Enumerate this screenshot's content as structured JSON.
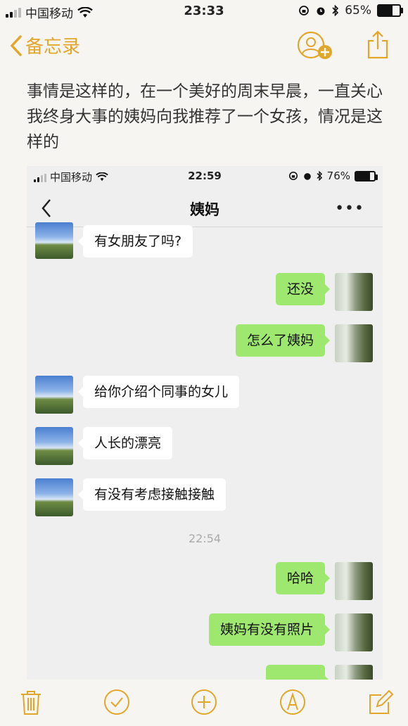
{
  "status": {
    "carrier": "中国移动",
    "time": "23:33",
    "battery": "65%",
    "battery_level": 0.65
  },
  "nav": {
    "back_label": "备忘录"
  },
  "note": {
    "text": "事情是这样的，在一个美好的周末早晨，一直关心我终身大事的姨妈向我推荐了一个女孩，情况是这样的"
  },
  "screenshot": {
    "status": {
      "carrier": "中国移动",
      "time": "22:59",
      "battery": "76%",
      "battery_level": 0.76
    },
    "chat_title": "姨妈",
    "more": "•••",
    "messages": [
      {
        "side": "in",
        "text": "有女朋友了吗?"
      },
      {
        "side": "out",
        "text": "还没"
      },
      {
        "side": "out",
        "text": "怎么了姨妈"
      },
      {
        "side": "in",
        "text": "给你介绍个同事的女儿"
      },
      {
        "side": "in",
        "text": "人长的漂亮"
      },
      {
        "side": "in",
        "text": "有没有考虑接触接触"
      },
      {
        "side": "out",
        "text": "哈哈"
      },
      {
        "side": "out",
        "text": "姨妈有没有照片"
      }
    ],
    "timestamp": "22:54"
  },
  "colors": {
    "accent": "#e2a72a",
    "bubble_out": "#9fe870",
    "bubble_in": "#ffffff"
  },
  "icons": [
    "trash-icon",
    "checklist-icon",
    "add-icon",
    "markup-pen-icon",
    "compose-icon"
  ]
}
